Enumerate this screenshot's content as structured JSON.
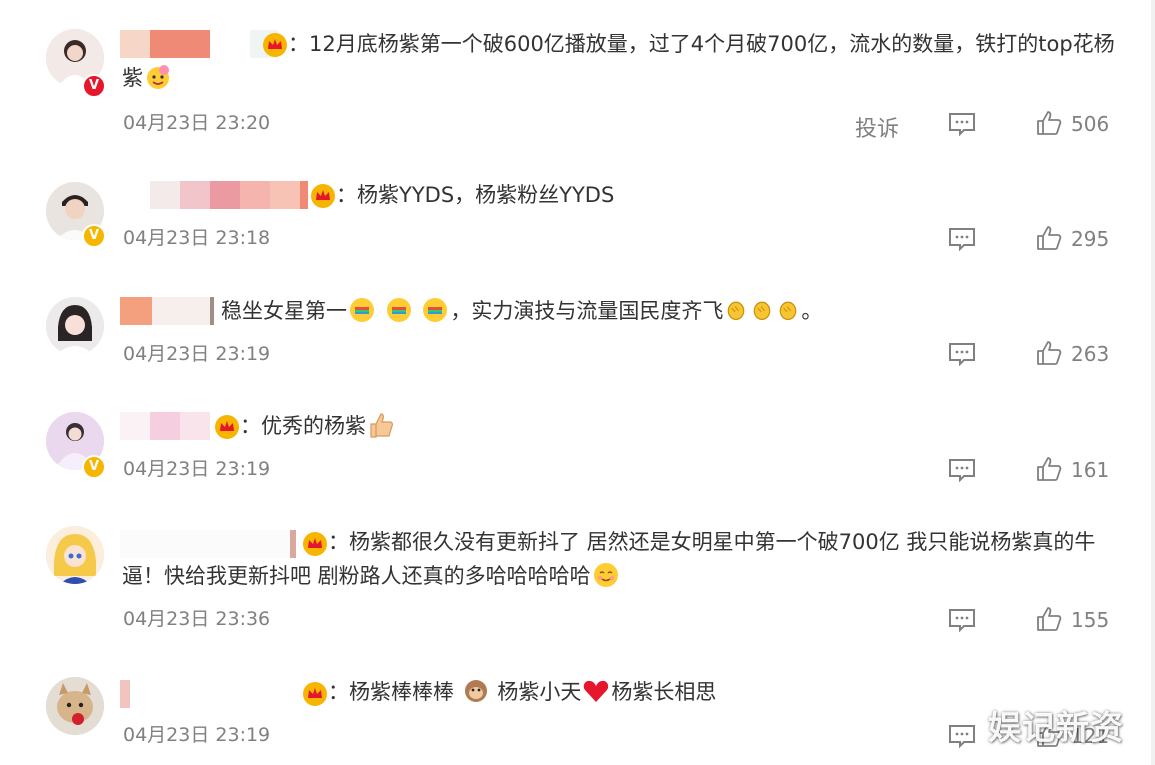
{
  "comments": [
    {
      "text": "：12月底杨紫第一个破600亿播放量，过了4个月破700亿，流水的数量，铁打的top花杨紫",
      "time": "04月23日 23:20",
      "likes": "506",
      "report_label": "投诉",
      "badge": "V",
      "badge_color": "#e6162d"
    },
    {
      "text": "：杨紫YYDS，杨紫粉丝YYDS",
      "time": "04月23日 23:18",
      "likes": "295",
      "badge": "V",
      "badge_color": "#f7b500"
    },
    {
      "text_a": "稳坐女星第一",
      "text_b": "，实力演技与流量国民度齐飞",
      "text_c": "。",
      "time": "04月23日 23:19",
      "likes": "263"
    },
    {
      "text": "：优秀的杨紫",
      "time": "04月23日 23:19",
      "likes": "161",
      "badge": "V",
      "badge_color": "#f7b500"
    },
    {
      "text": "：杨紫都很久没有更新抖了 居然还是女明星中第一个破700亿 我只能说杨紫真的牛逼！快给我更新抖吧 剧粉路人还真的多哈哈哈哈哈",
      "time": "04月23日 23:36",
      "likes": "155"
    },
    {
      "text_a": "：杨紫棒棒棒 ",
      "text_b": " 杨紫小天",
      "text_c": "杨紫长相思",
      "time": "04月23日 23:19",
      "likes": "121"
    }
  ],
  "watermark": "娱记新资",
  "icons": {
    "crown": "crown-icon",
    "comment": "comment-icon",
    "like": "like-icon"
  }
}
